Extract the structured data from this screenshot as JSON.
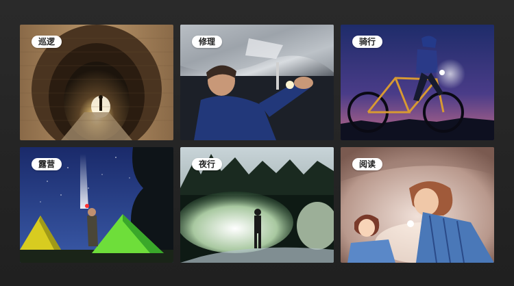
{
  "scenes": [
    {
      "label": "巡逻",
      "icon": "tunnel-patrol-scene"
    },
    {
      "label": "修理",
      "icon": "car-repair-scene"
    },
    {
      "label": "骑行",
      "icon": "night-cycling-scene"
    },
    {
      "label": "露营",
      "icon": "camping-tents-scene"
    },
    {
      "label": "夜行",
      "icon": "night-walk-forest-scene"
    },
    {
      "label": "阅读",
      "icon": "reading-under-blanket-scene"
    }
  ],
  "colors": {
    "background": "#252525",
    "pill_background": "#ffffff",
    "pill_text": "#222222"
  }
}
